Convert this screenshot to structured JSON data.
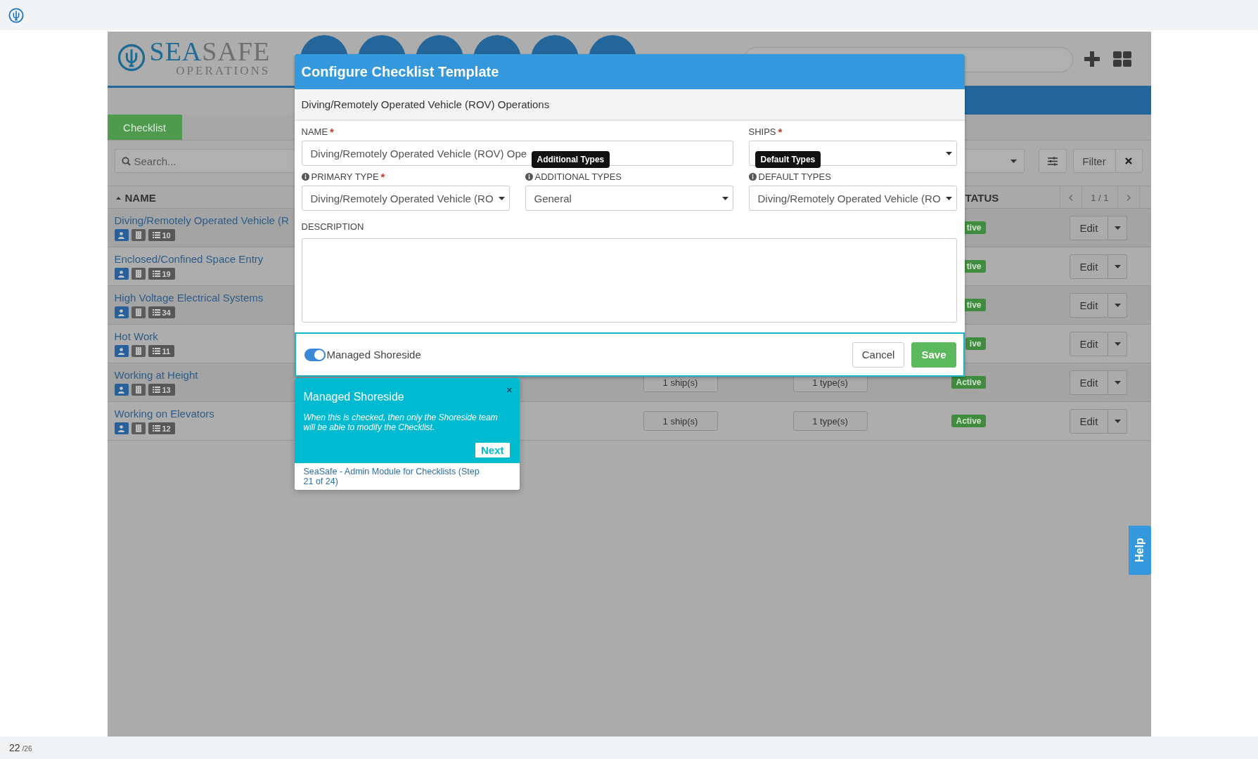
{
  "app": {
    "brand": {
      "primary": "SEA",
      "secondary": "SAFE",
      "tagline": "OPERATIONS"
    },
    "section_tab": {
      "label": "Checklist",
      "selected": true
    },
    "search": {
      "placeholder": "Search..."
    },
    "filter_button": "Filter",
    "table": {
      "columns": [
        {
          "label": "NAME",
          "sorted": true
        },
        {
          "label": "TATUS",
          "sorted": false
        }
      ],
      "pager": "1 / 1",
      "rows": [
        {
          "name": "Diving/Remotely Operated Vehicle (R",
          "count": "10",
          "status": "tive",
          "action": "Edit"
        },
        {
          "name": "Enclosed/Confined Space Entry",
          "count": "19",
          "status": "tive",
          "action": "Edit"
        },
        {
          "name": "High Voltage Electrical Systems",
          "count": "34",
          "status": "tive",
          "action": "Edit"
        },
        {
          "name": "Hot Work",
          "count": "11",
          "status": "ive",
          "action": "Edit"
        },
        {
          "name": "Working at Height",
          "count": "13",
          "ships": "1 ship(s)",
          "types": "1 type(s)",
          "status": "Active",
          "action": "Edit"
        },
        {
          "name": "Working on Elevators",
          "count": "12",
          "ships": "1 ship(s)",
          "types": "1 type(s)",
          "status": "Active",
          "action": "Edit"
        }
      ]
    }
  },
  "modal": {
    "title": "Configure Checklist Template",
    "subtitle": "Diving/Remotely Operated Vehicle (ROV) Operations",
    "fields": [
      {
        "kind": "text",
        "label": "NAME",
        "required_mark": "*",
        "info": false,
        "value": "Diving/Remotely Operated Vehicle (ROV) Ope"
      },
      {
        "kind": "select",
        "label": "SHIPS",
        "required_mark": "*",
        "info": false
      },
      {
        "kind": "select",
        "label": "PRIMARY TYPE",
        "required_mark": "*",
        "info": true,
        "value": "Diving/Remotely Operated Vehicle (RO"
      },
      {
        "kind": "select",
        "label": "ADDITIONAL TYPES",
        "info": true,
        "value": "General",
        "tooltip": "Additional Types"
      },
      {
        "kind": "select",
        "label": "DEFAULT TYPES",
        "info": true,
        "value": "Diving/Remotely Operated Vehicle (RO",
        "tooltip": "Default Types"
      },
      {
        "kind": "textarea",
        "label": "DESCRIPTION",
        "info": false
      }
    ],
    "managed_shoreside": {
      "label": "Managed Shoreside",
      "on": true
    },
    "buttons": [
      {
        "kind": "secondary",
        "label": "Cancel"
      },
      {
        "kind": "primary",
        "label": "Save"
      }
    ]
  },
  "tour": {
    "title": "Managed Shoreside",
    "close": "×",
    "text": "When this is checked, then only the Shoreside team will be able to modify the Checklist.",
    "next": "Next",
    "footer": "SeaSafe - Admin Module for Checklists (Step 21 of 24)"
  },
  "help": "Help",
  "page_counter": {
    "current": "22",
    "total": "/26"
  }
}
